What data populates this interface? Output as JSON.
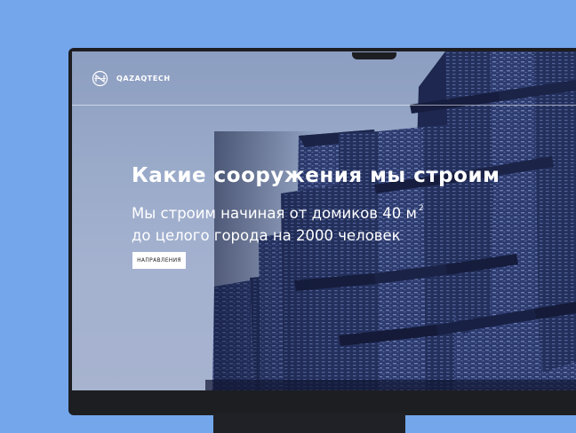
{
  "header": {
    "brand": "QAZAQTECH",
    "logo_icon": "qazaqtech-logo-icon"
  },
  "hero": {
    "title": "Какие сооружения мы строим",
    "subtitle_line1": "Мы строим начиная от домиков 40 м",
    "subtitle_sup": "2",
    "subtitle_line2": "до целого города на 2000 человек",
    "cta_label": "НАПРАВЛЕНИЯ"
  },
  "colors": {
    "background": "#74a6ec",
    "monitor": "#1d1e22",
    "sky": "#9aaac9",
    "building": "#2d3a6b"
  }
}
